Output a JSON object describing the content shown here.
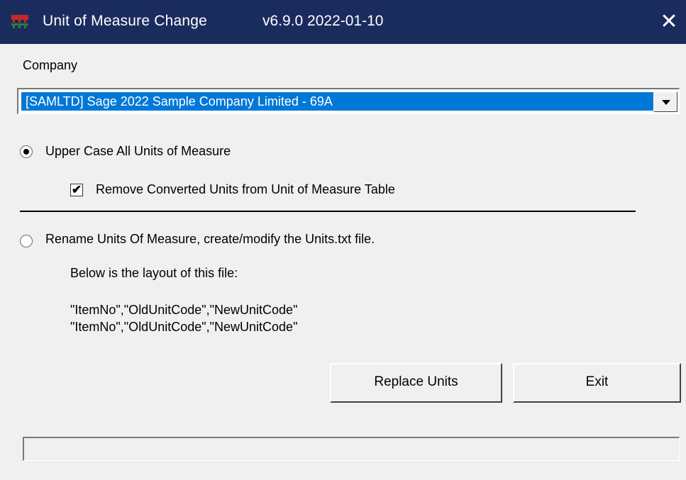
{
  "window": {
    "title": "Unit of Measure Change",
    "version": "v6.9.0  2022-01-10",
    "close_label": "✕"
  },
  "company": {
    "label": "Company",
    "selected": "[SAMLTD] Sage 2022 Sample Company Limited  - 69A"
  },
  "options": {
    "uppercase_label": "Upper Case All Units of Measure",
    "uppercase_checked": true,
    "remove_label": "Remove Converted Units from Unit of Measure Table",
    "remove_checked": true,
    "rename_label": "Rename Units Of Measure, create/modify the Units.txt file.",
    "rename_checked": false,
    "layout_intro": "Below is the layout of this file:",
    "layout_line1": "\"ItemNo\",\"OldUnitCode\",\"NewUnitCode\"",
    "layout_line2": "\"ItemNo\",\"OldUnitCode\",\"NewUnitCode\""
  },
  "buttons": {
    "replace_label": "Replace Units",
    "exit_label": "Exit"
  },
  "status": {
    "text": ""
  },
  "colors": {
    "titlebar": "#1a2b5e",
    "selection": "#0078d7",
    "background": "#f0f0f0"
  },
  "icons": {
    "app": "app-icon",
    "close": "close-icon",
    "dropdown": "chevron-down-icon"
  }
}
